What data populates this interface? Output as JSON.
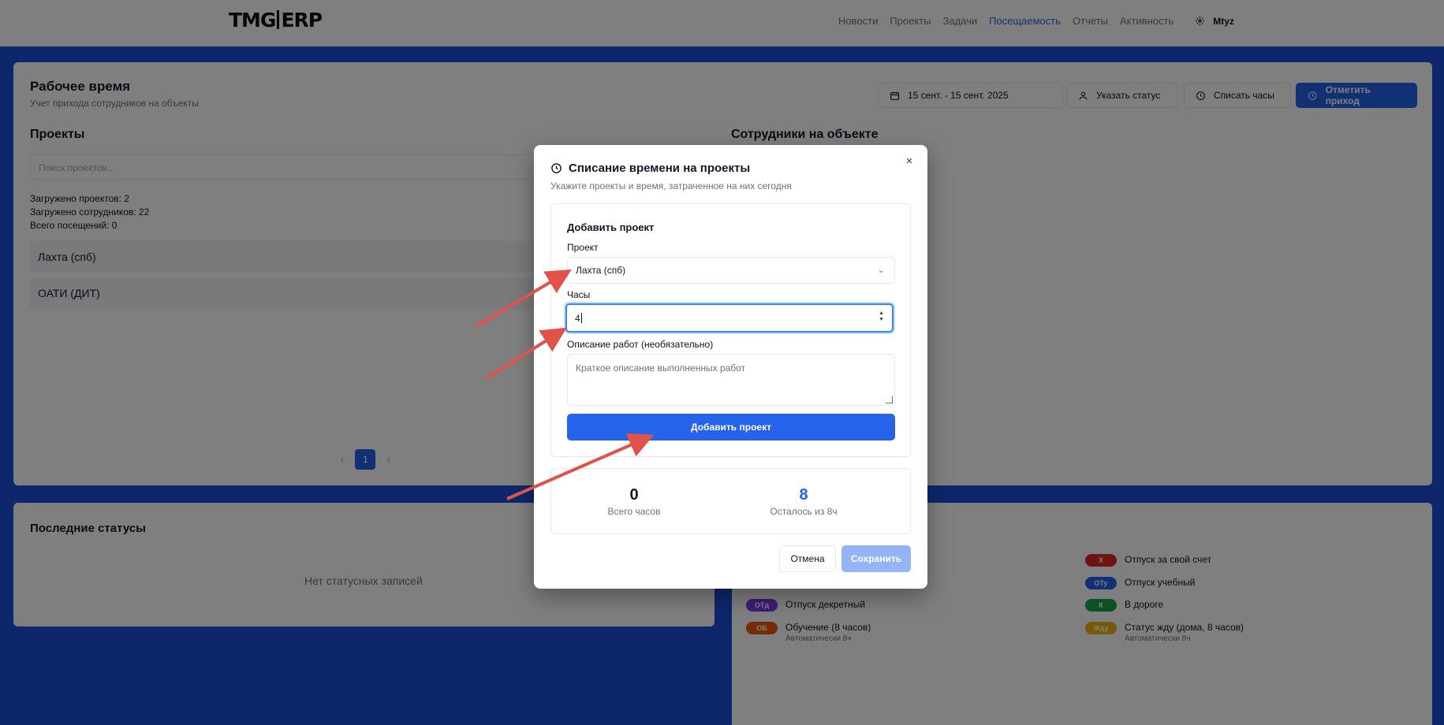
{
  "header": {
    "logo_left": "TMG",
    "logo_right": "ERP",
    "nav": [
      "Новости",
      "Проекты",
      "Задачи",
      "Посещаемость",
      "Отчеты",
      "Активность"
    ],
    "user": "Mtyz"
  },
  "page": {
    "title": "Рабочее время",
    "subtitle": "Учет прихода сотрудников на объекты",
    "date_range": "15 сент. - 15 сент. 2025",
    "btn_status": "Указать статус",
    "btn_hours": "Списать часы",
    "btn_checkin": "Отметить приход",
    "projects_title": "Проекты",
    "search_placeholder": "Поиск проектов...",
    "stats": [
      "Загружено проектов: 2",
      "Загружено сотрудников: 22",
      "Всего посещений: 0"
    ],
    "projects": [
      "Лахта (спб)",
      "ОАТИ (ДИТ)"
    ],
    "page_number": "1",
    "employees_title": "Сотрудники на объекте",
    "recent_title": "Последние статусы",
    "recent_empty": "Нет статусных записей"
  },
  "legend": [
    {
      "code": "Х",
      "label": "Отпуск за свой счет",
      "color": "#dc2626",
      "note": ""
    },
    {
      "code": "ОТу",
      "label": "Отпуск учебный",
      "color": "#2563eb",
      "note": ""
    },
    {
      "code": "ОТд",
      "label": "Отпуск декретный",
      "color": "#7c3aed",
      "note": ""
    },
    {
      "code": "К",
      "label": "В дороге",
      "color": "#16a34a",
      "note": ""
    },
    {
      "code": "ОБ",
      "label": "Обучение (8 часов)",
      "color": "#ea580c",
      "note": "Автоматически 8ч"
    },
    {
      "code": "Жду",
      "label": "Статус жду (дома, 8 часов)",
      "color": "#eab308",
      "note": "Автоматически 8ч"
    }
  ],
  "modal": {
    "title": "Списание времени на проекты",
    "subtitle": "Укажите проекты и время, затраченное на них сегодня",
    "section_title": "Добавить проект",
    "project_label": "Проект",
    "project_value": "Лахта (спб)",
    "hours_label": "Часы",
    "hours_value": "4",
    "desc_label": "Описание работ (необязательно)",
    "desc_placeholder": "Краткое описание выполненных работ",
    "add_button": "Добавить проект",
    "total_hours": "0",
    "total_label": "Всего часов",
    "remaining_hours": "8",
    "remaining_label": "Осталось из 8ч",
    "cancel": "Отмена",
    "save": "Сохранить",
    "close": "×"
  },
  "colors": {
    "accent": "#2563eb",
    "annotation_arrow": "#e0524a"
  }
}
